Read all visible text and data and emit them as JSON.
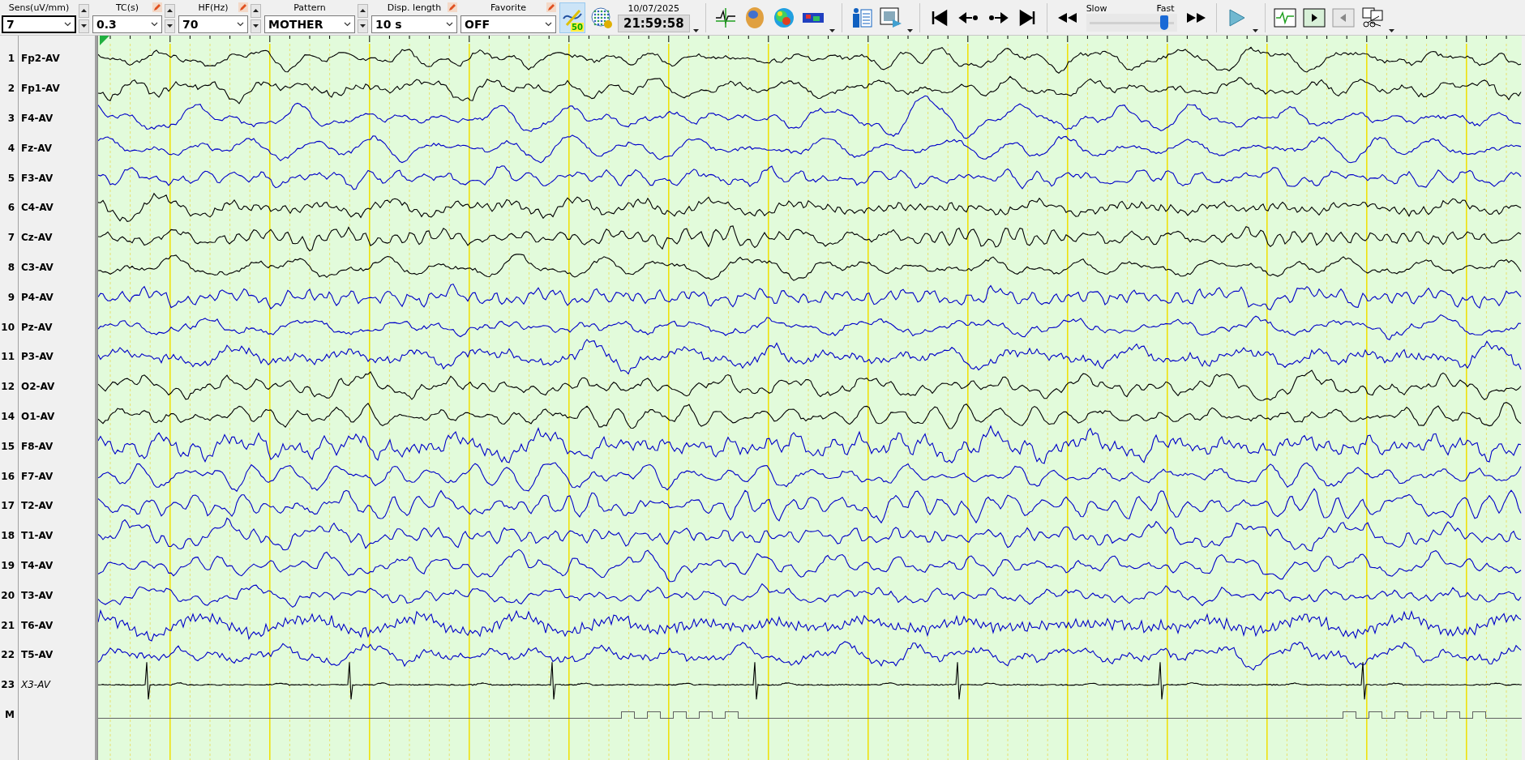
{
  "toolbar": {
    "controls": [
      {
        "label": "Sens(uV/mm)",
        "value": "7",
        "pencil": false,
        "spinner": true
      },
      {
        "label": "TC(s)",
        "value": "0.3",
        "pencil": true,
        "spinner": true
      },
      {
        "label": "HF(Hz)",
        "value": "70",
        "pencil": true,
        "spinner": true
      },
      {
        "label": "Pattern",
        "value": "MOTHER",
        "pencil": false,
        "spinner": true
      },
      {
        "label": "Disp. length",
        "value": "10 s",
        "pencil": true,
        "spinner": false
      },
      {
        "label": "Favorite",
        "value": "OFF",
        "pencil": true,
        "spinner": false
      }
    ],
    "montage_button": {
      "badge": "50",
      "selected": true
    },
    "date": "10/07/2025",
    "time": "21:59:58",
    "speed": {
      "slow_label": "Slow",
      "fast_label": "Fast",
      "level": 0.86
    }
  },
  "channels": [
    {
      "number": "1",
      "name": "Fp2-AV",
      "color": "#000000",
      "kind": "eeg"
    },
    {
      "number": "2",
      "name": "Fp1-AV",
      "color": "#000000",
      "kind": "eeg"
    },
    {
      "number": "3",
      "name": "F4-AV",
      "color": "#0000c8",
      "kind": "eeg"
    },
    {
      "number": "4",
      "name": "Fz-AV",
      "color": "#0000c8",
      "kind": "eeg"
    },
    {
      "number": "5",
      "name": "F3-AV",
      "color": "#0000c8",
      "kind": "eeg"
    },
    {
      "number": "6",
      "name": "C4-AV",
      "color": "#000000",
      "kind": "eeg"
    },
    {
      "number": "7",
      "name": "Cz-AV",
      "color": "#000000",
      "kind": "eeg"
    },
    {
      "number": "8",
      "name": "C3-AV",
      "color": "#000000",
      "kind": "eeg"
    },
    {
      "number": "9",
      "name": "P4-AV",
      "color": "#0000c8",
      "kind": "eeg"
    },
    {
      "number": "10",
      "name": "Pz-AV",
      "color": "#0000c8",
      "kind": "eeg"
    },
    {
      "number": "11",
      "name": "P3-AV",
      "color": "#0000c8",
      "kind": "eeg"
    },
    {
      "number": "12",
      "name": "O2-AV",
      "color": "#000000",
      "kind": "eeg"
    },
    {
      "number": "14",
      "name": "O1-AV",
      "color": "#000000",
      "kind": "eeg"
    },
    {
      "number": "15",
      "name": "F8-AV",
      "color": "#0000c8",
      "kind": "eeg"
    },
    {
      "number": "16",
      "name": "F7-AV",
      "color": "#0000c8",
      "kind": "eeg"
    },
    {
      "number": "17",
      "name": "T2-AV",
      "color": "#0000c8",
      "kind": "eeg"
    },
    {
      "number": "18",
      "name": "T1-AV",
      "color": "#0000c8",
      "kind": "eeg"
    },
    {
      "number": "19",
      "name": "T4-AV",
      "color": "#0000c8",
      "kind": "eeg"
    },
    {
      "number": "20",
      "name": "T3-AV",
      "color": "#0000c8",
      "kind": "eeg"
    },
    {
      "number": "21",
      "name": "T6-AV",
      "color": "#0000c8",
      "kind": "eeg"
    },
    {
      "number": "22",
      "name": "T5-AV",
      "color": "#0000c8",
      "kind": "eeg"
    },
    {
      "number": "23",
      "name": "X3-AV",
      "color": "#000000",
      "kind": "ecg"
    },
    {
      "number": "M",
      "color": "#606060",
      "kind": "marker"
    }
  ]
}
